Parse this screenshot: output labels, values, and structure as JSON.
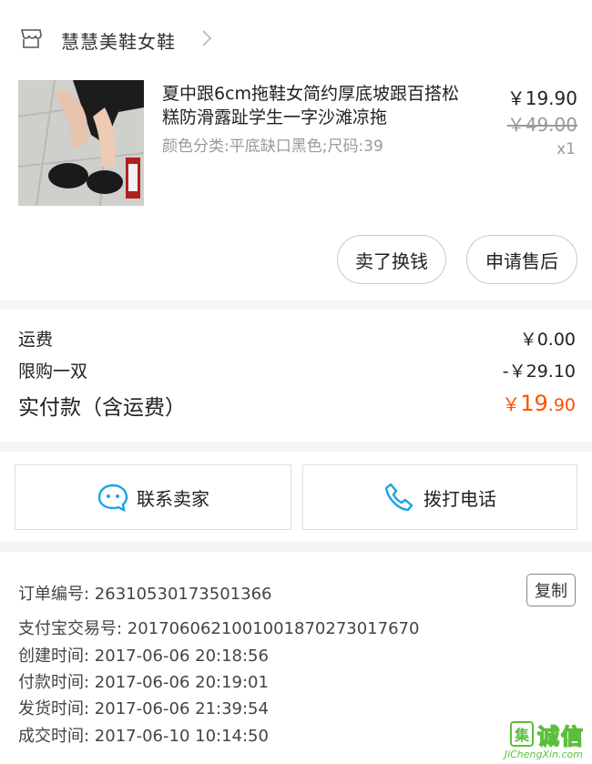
{
  "shop": {
    "name": "慧慧美鞋女鞋",
    "icon": "store-icon",
    "chevron": "chevron-right-icon"
  },
  "product": {
    "title": "夏中跟6cm拖鞋女简约厚底坡跟百搭松糕防滑露趾学生一字沙滩凉拖",
    "sku": "颜色分类:平底缺口黑色;尺码:39",
    "price": "￥19.90",
    "original_price": "￥49.00",
    "quantity": "x1",
    "buttons": {
      "sell": "卖了换钱",
      "after_sale": "申请售后"
    }
  },
  "fees": {
    "shipping_label": "运费",
    "shipping_value": "￥0.00",
    "discount_label": "限购一双",
    "discount_value": "-￥29.10",
    "paid_label": "实付款（含运费）",
    "paid_currency": "￥",
    "paid_integer": "19",
    "paid_decimal": ".90"
  },
  "contact": {
    "seller_label": "联系卖家",
    "phone_label": "拨打电话"
  },
  "order": {
    "order_no": "订单编号: 26310530173501366",
    "copy_label": "复制",
    "alipay_no": "支付宝交易号: 2017060621001001870273017670",
    "created": "创建时间: 2017-06-06 20:18:56",
    "paid": "付款时间: 2017-06-06 20:19:01",
    "shipped": "发货时间: 2017-06-06 21:39:54",
    "completed": "成交时间: 2017-06-10 10:14:50"
  },
  "watermark": {
    "box": "集",
    "text": "诚信",
    "url": "JiChengXin.com"
  },
  "colors": {
    "accent": "#ff5000",
    "icon_blue": "#1aa3e8",
    "watermark": "#5bbf3c"
  }
}
